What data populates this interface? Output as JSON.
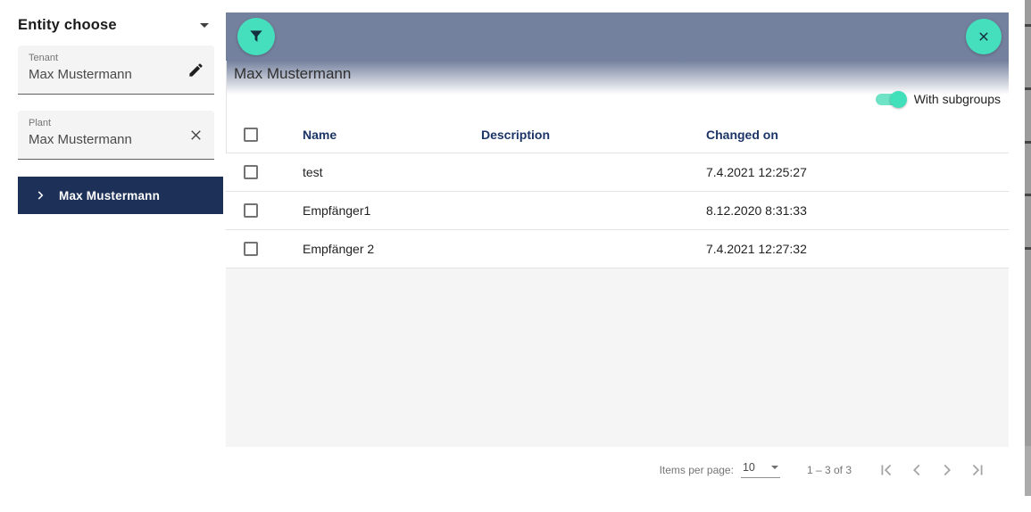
{
  "sidebar": {
    "title": "Entity choose",
    "tenant": {
      "label": "Tenant",
      "value": "Max Mustermann"
    },
    "plant": {
      "label": "Plant",
      "value": "Max Mustermann"
    },
    "nav_item": {
      "label": "Max Mustermann"
    }
  },
  "panel": {
    "title": "Max Mustermann",
    "subgroups_toggle": {
      "label": "With subgroups",
      "state": "on"
    },
    "table": {
      "headers": {
        "name": "Name",
        "description": "Description",
        "changed_on": "Changed on"
      },
      "rows": [
        {
          "name": "test",
          "description": "",
          "changed_on": "7.4.2021 12:25:27"
        },
        {
          "name": "Empfänger1",
          "description": "",
          "changed_on": "8.12.2020 8:31:33"
        },
        {
          "name": "Empfänger 2",
          "description": "",
          "changed_on": "7.4.2021 12:27:32"
        }
      ]
    },
    "paginator": {
      "items_per_page_label": "Items per page:",
      "items_per_page_value": "10",
      "range_label": "1 – 3 of 3"
    }
  },
  "icons": {
    "filter": "funnel-icon",
    "close": "close-icon",
    "edit": "pencil-icon",
    "clear": "x-icon",
    "expand": "chevron-right-icon",
    "collapse": "caret-down-icon",
    "pagination": [
      "first-page-icon",
      "previous-page-icon",
      "next-page-icon",
      "last-page-icon"
    ]
  },
  "colors": {
    "accent_teal": "#45DFBD",
    "appbar_slate": "#74819E",
    "sidebar_navy": "#1D3058",
    "table_header_text": "#1C3566"
  }
}
